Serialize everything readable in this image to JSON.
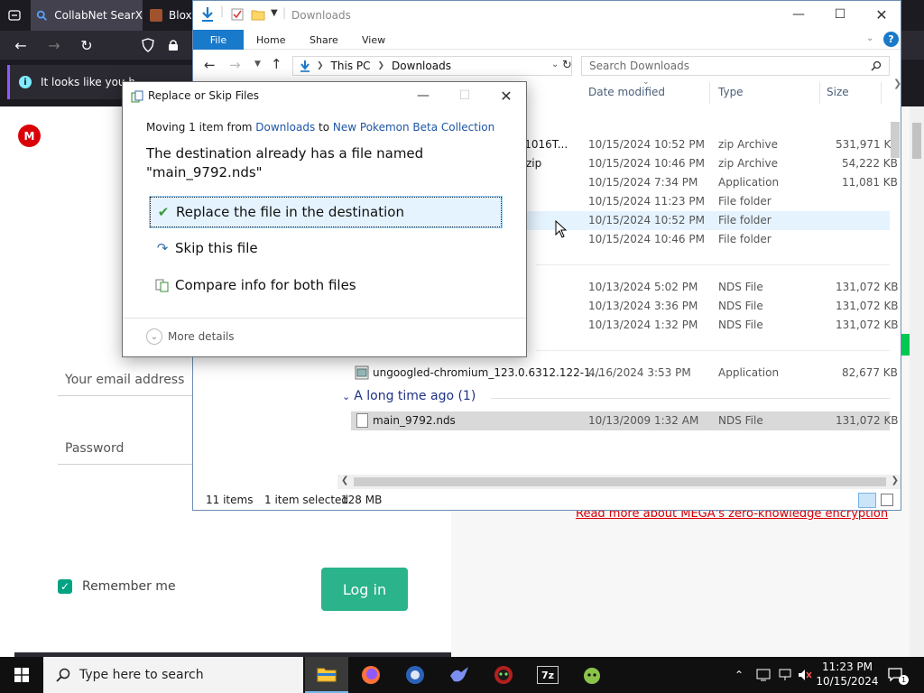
{
  "browser": {
    "tabs": [
      {
        "label": "CollabNet SearX"
      },
      {
        "label": "Blox"
      }
    ],
    "notification": "It looks like you h",
    "page": {
      "logo": "M",
      "email_placeholder": "Your email address",
      "password_placeholder": "Password",
      "remember_label": "Remember me",
      "login_label": "Log in",
      "encryption_link": "Read more about MEGA's zero-knowledge encryption"
    }
  },
  "explorer": {
    "title": "Downloads",
    "ribbon_tabs": [
      "File",
      "Home",
      "Share",
      "View"
    ],
    "address": {
      "root": "This PC",
      "folder": "Downloads"
    },
    "search_placeholder": "Search Downloads",
    "columns": {
      "date": "Date modified",
      "type": "Type",
      "size": "Size"
    },
    "rows": [
      {
        "name": "241016T...",
        "date": "10/15/2024 10:52 PM",
        "type": "zip Archive",
        "size": "531,971 KB"
      },
      {
        "name": "zip",
        "date": "10/15/2024 10:46 PM",
        "type": "zip Archive",
        "size": "54,222 KB"
      },
      {
        "name": "",
        "date": "10/15/2024 7:34 PM",
        "type": "Application",
        "size": "11,081 KB"
      },
      {
        "name": "",
        "date": "10/15/2024 11:23 PM",
        "type": "File folder",
        "size": ""
      },
      {
        "name": "",
        "date": "10/15/2024 10:52 PM",
        "type": "File folder",
        "size": ""
      },
      {
        "name": "",
        "date": "10/15/2024 10:46 PM",
        "type": "File folder",
        "size": ""
      },
      {
        "name": "",
        "date": "10/13/2024 5:02 PM",
        "type": "NDS File",
        "size": "131,072 KB"
      },
      {
        "name": "",
        "date": "10/13/2024 3:36 PM",
        "type": "NDS File",
        "size": "131,072 KB"
      },
      {
        "name": "",
        "date": "10/13/2024 1:32 PM",
        "type": "NDS File",
        "size": "131,072 KB"
      },
      {
        "name": "ungoogled-chromium_123.0.6312.122-1....",
        "date": "4/16/2024 3:53 PM",
        "type": "Application",
        "size": "82,677 KB"
      },
      {
        "name": "main_9792.nds",
        "date": "10/13/2009 1:32 AM",
        "type": "NDS File",
        "size": "131,072 KB"
      }
    ],
    "group_label": "A long time ago (1)",
    "status": {
      "items": "11 items",
      "selected": "1 item selected",
      "size": "128 MB"
    }
  },
  "dialog": {
    "title": "Replace or Skip Files",
    "moving_prefix": "Moving 1 item from",
    "source": "Downloads",
    "to_word": "to",
    "destination": "New Pokemon Beta Collection",
    "heading": "The destination already has a file named \"main_9792.nds\"",
    "options": [
      {
        "label": "Replace the file in the destination"
      },
      {
        "label": "Skip this file"
      },
      {
        "label": "Compare info for both files"
      }
    ],
    "more_details": "More details"
  },
  "taskbar": {
    "search_placeholder": "Type here to search",
    "time": "11:23 PM",
    "date": "10/15/2024",
    "notification_count": "1"
  }
}
